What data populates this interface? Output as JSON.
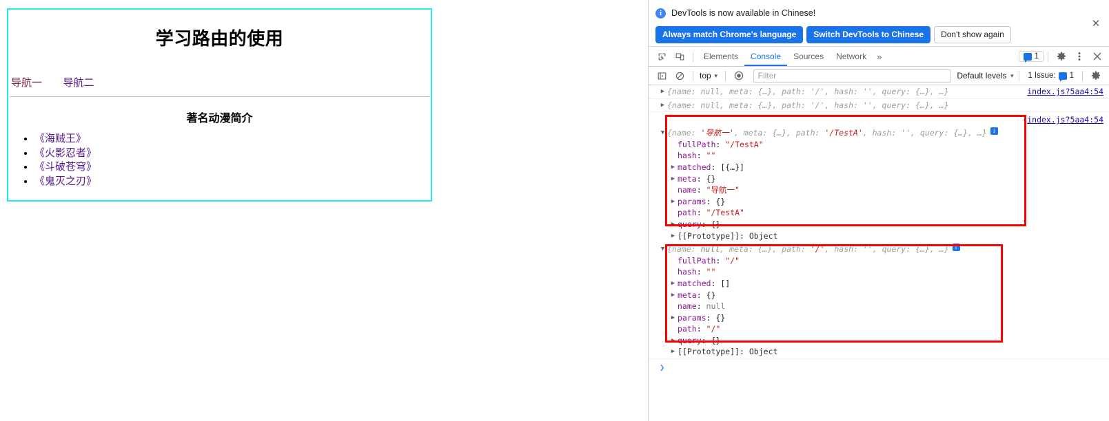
{
  "page": {
    "title": "学习路由的使用",
    "nav": [
      {
        "label": "导航一"
      },
      {
        "label": "导航二"
      }
    ],
    "section_title": "著名动漫简介",
    "list": [
      "《海贼王》",
      "《火影忍者》",
      "《斗破苍穹》",
      "《鬼灭之刃》"
    ],
    "border_color": "#22e9ef",
    "link_color": "#551a8b"
  },
  "devtools": {
    "banner": {
      "info_icon": "info-icon",
      "message": "DevTools is now available in Chinese!",
      "buttons": [
        {
          "label": "Always match Chrome's language",
          "style": "primary"
        },
        {
          "label": "Switch DevTools to Chinese",
          "style": "primary"
        },
        {
          "label": "Don't show again",
          "style": "secondary"
        }
      ],
      "close_label": "✕"
    },
    "tabbar": {
      "inspect_icon": "inspect-element-icon",
      "device_icon": "device-toolbar-icon",
      "tabs": [
        {
          "label": "Elements",
          "active": false
        },
        {
          "label": "Console",
          "active": true
        },
        {
          "label": "Sources",
          "active": false
        },
        {
          "label": "Network",
          "active": false
        }
      ],
      "more_label": "»",
      "message_count": "1",
      "settings_icon": "gear-icon",
      "kebab_icon": "more-options-icon",
      "close_icon": "close-devtools-icon"
    },
    "filterbar": {
      "sidebar_icon": "console-sidebar-icon",
      "clear_icon": "clear-console-icon",
      "context": "top",
      "eye_icon": "live-expression-icon",
      "filter_placeholder": "Filter",
      "filter_value": "",
      "levels_label": "Default levels",
      "issues_label": "1 Issue:",
      "issues_count": "1",
      "console_settings_icon": "gear-icon"
    },
    "console": {
      "source_link_1": "index.js?5aa4:54",
      "source_link_2": "index.js?5aa4:54",
      "collapsed_lines": [
        "{name: null, meta: {…}, path: '/', hash: '', query: {…}, …}",
        "{name: null, meta: {…}, path: '/', hash: '', query: {…}, …}"
      ],
      "object_a": {
        "header_prefix": "{name: ",
        "header_name": "'导航一'",
        "header_mid": ", meta: {…}, path: ",
        "header_path": "'/TestA'",
        "header_tail": ", hash: '', query: {…}, …}",
        "props": [
          {
            "arrow": "",
            "key": "fullPath",
            "value": "\"/TestA\"",
            "vtype": "string"
          },
          {
            "arrow": "",
            "key": "hash",
            "value": "\"\"",
            "vtype": "string"
          },
          {
            "arrow": "▶",
            "key": "matched",
            "value": "[{…}]",
            "vtype": "plain"
          },
          {
            "arrow": "▶",
            "key": "meta",
            "value": "{}",
            "vtype": "plain"
          },
          {
            "arrow": "",
            "key": "name",
            "value": "\"导航一\"",
            "vtype": "string"
          },
          {
            "arrow": "▶",
            "key": "params",
            "value": "{}",
            "vtype": "plain"
          },
          {
            "arrow": "",
            "key": "path",
            "value": "\"/TestA\"",
            "vtype": "string"
          },
          {
            "arrow": "▶",
            "key": "query",
            "value": "{}",
            "vtype": "plain"
          },
          {
            "arrow": "▶",
            "key": "[[Prototype]]",
            "value": "Object",
            "vtype": "proto"
          }
        ]
      },
      "object_b": {
        "header_prefix": "{name: ",
        "header_name": "null",
        "header_mid": ", meta: {…}, path: ",
        "header_path": "'/'",
        "header_tail": ", hash: '', query: {…}, …}",
        "props": [
          {
            "arrow": "",
            "key": "fullPath",
            "value": "\"/\"",
            "vtype": "string"
          },
          {
            "arrow": "",
            "key": "hash",
            "value": "\"\"",
            "vtype": "string"
          },
          {
            "arrow": "▶",
            "key": "matched",
            "value": "[]",
            "vtype": "plain"
          },
          {
            "arrow": "▶",
            "key": "meta",
            "value": "{}",
            "vtype": "plain"
          },
          {
            "arrow": "",
            "key": "name",
            "value": "null",
            "vtype": "null"
          },
          {
            "arrow": "▶",
            "key": "params",
            "value": "{}",
            "vtype": "plain"
          },
          {
            "arrow": "",
            "key": "path",
            "value": "\"/\"",
            "vtype": "string"
          },
          {
            "arrow": "▶",
            "key": "query",
            "value": "{}",
            "vtype": "plain"
          },
          {
            "arrow": "▶",
            "key": "[[Prototype]]",
            "value": "Object",
            "vtype": "proto"
          }
        ]
      },
      "prompt_caret": "❯"
    },
    "annotation_color": "#ff0000"
  }
}
